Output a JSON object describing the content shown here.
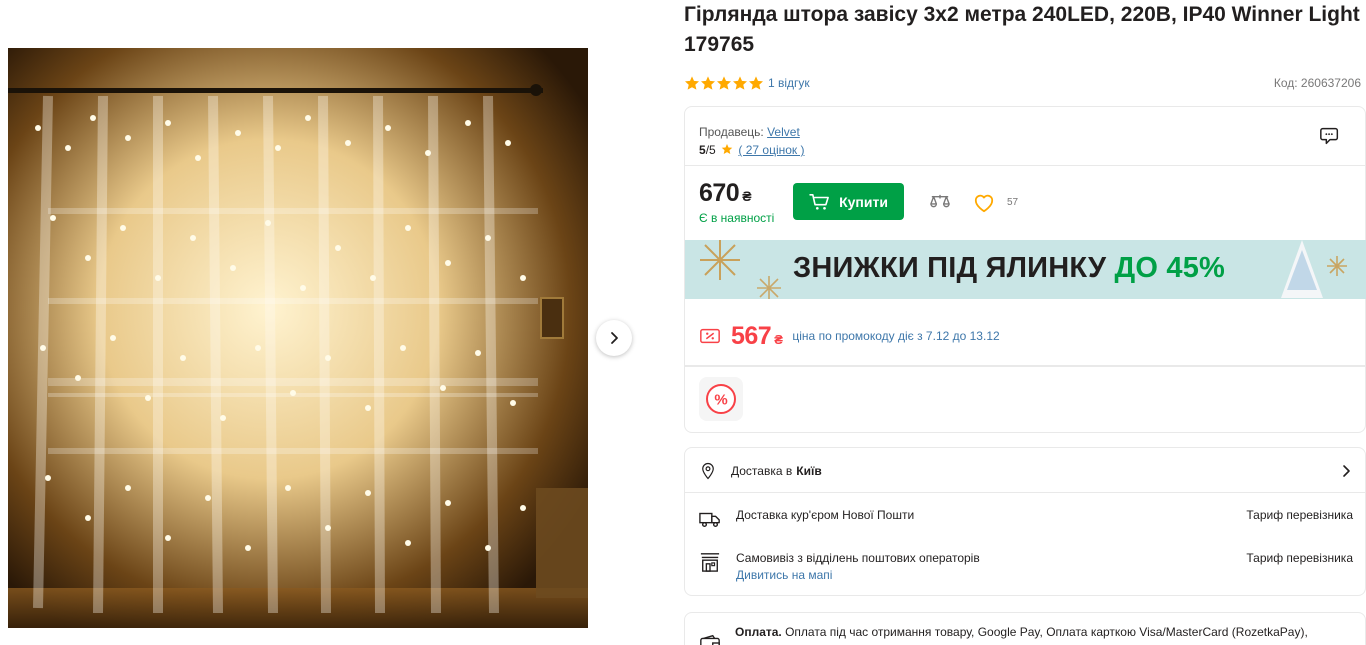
{
  "product": {
    "title": "Гірлянда штора завісу 3х2 метра 240LED, 220В, IP40 Winner Light 179765",
    "rating_stars": 5,
    "reviews_label": "1 відгук",
    "code_label": "Код:  260637206"
  },
  "seller": {
    "prefix": "Продавець: ",
    "name": "Velvet",
    "score": "5",
    "score_suffix": "/5",
    "ratings_link": "( 27 оцінок )"
  },
  "price": {
    "value": "670",
    "currency": "₴",
    "stock": "Є в наявності",
    "buy_label": "Купити",
    "favorites_count": "57"
  },
  "banner": {
    "text_main": "ЗНИЖКИ ПІД ЯЛИНКУ",
    "text_accent": "ДО 45%"
  },
  "promo": {
    "price": "567",
    "currency": "₴",
    "note": "ціна по промокоду діє з 7.12 до 13.12"
  },
  "delivery": {
    "head_prefix": "Доставка в",
    "city": "Київ",
    "rows": [
      {
        "label": "Доставка кур'єром Нової Пошти",
        "link": "",
        "tariff": "Тариф перевізника"
      },
      {
        "label": "Самовивіз з відділень поштових операторів",
        "link": "Дивитись на мапі",
        "tariff": "Тариф перевізника"
      }
    ]
  },
  "payment": {
    "label": "Оплата.",
    "text": " Оплата під час отримання товару, Google Pay, Оплата карткою Visa/MasterCard (RozetkaPay),"
  },
  "colors": {
    "green": "#00a046",
    "red": "#f84147",
    "link": "#3e77aa",
    "star": "#ffa900",
    "banner_bg": "#c9e5e5"
  }
}
